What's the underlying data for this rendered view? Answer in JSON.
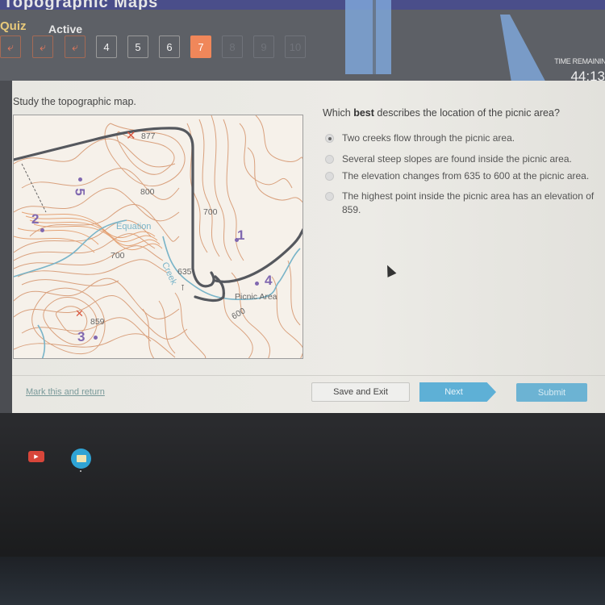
{
  "header": {
    "page_title": "Topographic Maps",
    "mode_label": "Quiz",
    "status_label": "Active",
    "nav": {
      "back_buttons": [
        "back",
        "back",
        "back"
      ],
      "question_numbers": [
        "4",
        "5",
        "6",
        "7",
        "8",
        "9",
        "10"
      ],
      "current_question": "7"
    },
    "time_label": "TIME REMAINING",
    "time_value": "44:13"
  },
  "left": {
    "instruction": "Study the topographic map.",
    "map": {
      "elevation_labels": [
        "877",
        "800",
        "700",
        "700",
        "635",
        "600",
        "859"
      ],
      "point_numbers": [
        "1",
        "2",
        "3",
        "4",
        "5"
      ],
      "creek_labels": [
        "Equation",
        "Creek"
      ],
      "picnic_label": "Picnic Area",
      "colors": {
        "contour": "#d4936a",
        "creek": "#79b4c8",
        "road": "#55585e",
        "points": "#8068b0",
        "peak_mark": "#d8563e"
      }
    }
  },
  "question": {
    "prefix": "Which ",
    "bold": "best",
    "suffix": " describes the location of the picnic area?",
    "options": [
      {
        "label": "Two creeks flow through the picnic area.",
        "selected": true
      },
      {
        "label": "Several steep slopes are found inside the picnic area.",
        "selected": false
      },
      {
        "label": "The elevation changes from 635 to 600 at the picnic area.",
        "selected": false
      },
      {
        "label": "The highest point inside the picnic area has an elevation of 859.",
        "selected": false
      }
    ]
  },
  "footer": {
    "mark_link": "Mark this and return",
    "save_exit": "Save and Exit",
    "next": "Next",
    "submit": "Submit"
  },
  "taskbar": {
    "icons": [
      "youtube-icon",
      "files-icon"
    ]
  }
}
